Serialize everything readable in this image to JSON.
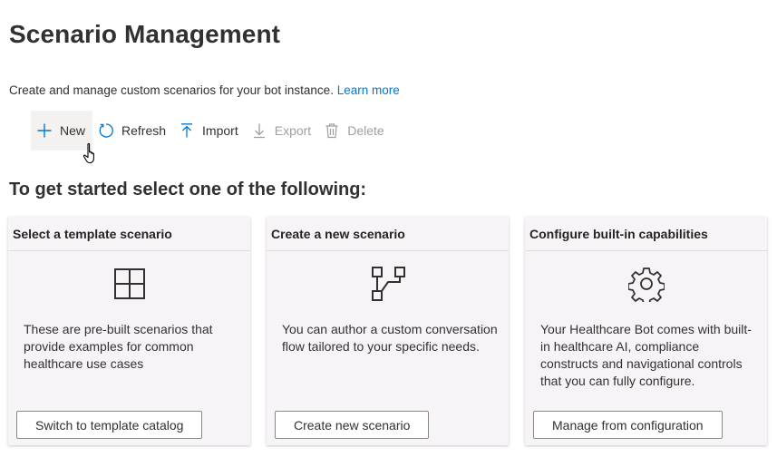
{
  "page": {
    "title": "Scenario Management",
    "subtitle": "Create and manage custom scenarios for your bot instance.",
    "learn_more": "Learn more"
  },
  "toolbar": {
    "new_label": "New",
    "refresh_label": "Refresh",
    "import_label": "Import",
    "export_label": "Export",
    "delete_label": "Delete"
  },
  "section_heading": "To get started select one of the following:",
  "cards": [
    {
      "title": "Select a template scenario",
      "icon": "grid-icon",
      "description": "These are pre-built scenarios that provide examples for common healthcare use cases",
      "button": "Switch to template catalog"
    },
    {
      "title": "Create a new scenario",
      "icon": "flow-icon",
      "description": "You can author a custom conversation flow tailored to your specific needs.",
      "button": "Create new scenario"
    },
    {
      "title": "Configure built-in capabilities",
      "icon": "gear-icon",
      "description": "Your Healthcare Bot comes with built-in healthcare AI, compliance constructs and navigational controls that you can fully configure.",
      "button": "Manage from configuration"
    }
  ],
  "colors": {
    "accent": "#0078d4",
    "text": "#323130",
    "disabled": "#a19f9d",
    "card_bg": "#f7f4f7"
  }
}
